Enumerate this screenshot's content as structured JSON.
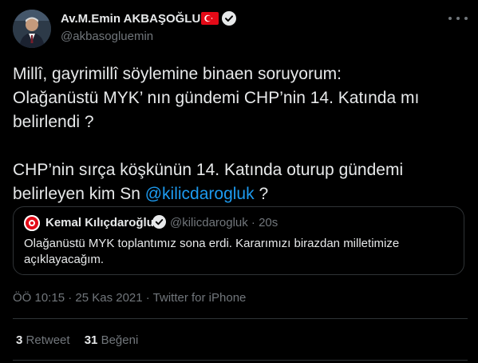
{
  "author": {
    "name": "Av.M.Emin AKBAŞOĞLU",
    "handle": "@akbasogluemin",
    "flag_icon": "turkey-flag-icon",
    "verified_icon": "verified-badge-icon"
  },
  "tweet": {
    "lines": [
      "Millî, gayrimillî söylemine binaen soruyorum:",
      "Olağanüstü MYK’ nın gündemi CHP’nin 14. Katında mı belirlendi ?",
      "CHP’nin sırça köşkünün 14. Katında oturup gündemi belirleyen kim Sn ",
      "@kilicdarogluk",
      " ?"
    ]
  },
  "quote": {
    "name": "Kemal Kılıçdaroğlu",
    "handle_time": "@kilicdarogluk · 20s",
    "text": "Olağanüstü MYK toplantımız sona erdi. Kararımızı birazdan milletimize açıklayacağım."
  },
  "meta": {
    "text": "ÖÖ 10:15 · 25 Kas 2021 · Twitter for iPhone"
  },
  "stats": {
    "retweets_count": "3",
    "retweets_label": "Retweet",
    "likes_count": "31",
    "likes_label": "Beğeni"
  },
  "colors": {
    "background": "#000000",
    "text": "#e7e9ea",
    "secondary": "#71767b",
    "accent": "#1d9bf0",
    "border": "#2f3336"
  }
}
